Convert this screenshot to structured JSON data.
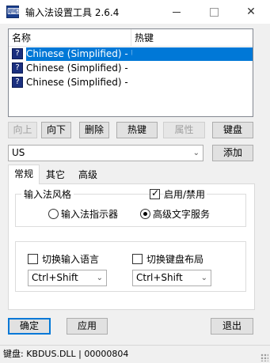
{
  "window": {
    "title": "输入法设置工具 2.6.4"
  },
  "list": {
    "columns": [
      "名称",
      "热键"
    ],
    "rows": [
      {
        "name": "Chinese (Simplified) - US...",
        "hotkey": "",
        "selected": true
      },
      {
        "name": "Chinese (Simplified) - US...",
        "hotkey": "",
        "selected": false
      },
      {
        "name": "Chinese (Simplified) - US...",
        "hotkey": "",
        "selected": false
      }
    ]
  },
  "actions": {
    "up": "向上",
    "down": "向下",
    "delete": "删除",
    "hotkey": "热键",
    "properties": "属性",
    "keyboard": "键盘"
  },
  "layout_select": {
    "value": "US"
  },
  "add_label": "添加",
  "tabs": [
    "常规",
    "其它",
    "高级"
  ],
  "general": {
    "style_group": "输入法风格",
    "enable_label": "启用/禁用",
    "enable_checked": true,
    "radio_indicator": "输入法指示器",
    "radio_advanced": "高级文字服务",
    "advanced_selected": true,
    "switch_lang_label": "切换输入语言",
    "switch_lang_value": "Ctrl+Shift",
    "switch_kbd_label": "切换键盘布局",
    "switch_kbd_value": "Ctrl+Shift"
  },
  "footer": {
    "ok": "确定",
    "apply": "应用",
    "exit": "退出"
  },
  "status": "键盘: KBDUS.DLL | 00000804"
}
